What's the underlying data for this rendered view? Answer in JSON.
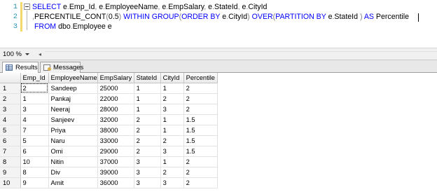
{
  "editor": {
    "lines": [
      {
        "number": "1",
        "tokens": [
          {
            "text": "SELECT",
            "kind": "kw"
          },
          {
            "text": " e",
            "kind": "pl"
          },
          {
            "text": ".",
            "kind": "op"
          },
          {
            "text": "Emp_Id",
            "kind": "pl"
          },
          {
            "text": ",",
            "kind": "op"
          },
          {
            "text": " e",
            "kind": "pl"
          },
          {
            "text": ".",
            "kind": "op"
          },
          {
            "text": "EmployeeName",
            "kind": "pl"
          },
          {
            "text": ",",
            "kind": "op"
          },
          {
            "text": " e",
            "kind": "pl"
          },
          {
            "text": ".",
            "kind": "op"
          },
          {
            "text": "EmpSalary",
            "kind": "pl"
          },
          {
            "text": ",",
            "kind": "op"
          },
          {
            "text": " e",
            "kind": "pl"
          },
          {
            "text": ".",
            "kind": "op"
          },
          {
            "text": "StateId",
            "kind": "pl"
          },
          {
            "text": ",",
            "kind": "op"
          },
          {
            "text": " e",
            "kind": "pl"
          },
          {
            "text": ".",
            "kind": "op"
          },
          {
            "text": "CityId",
            "kind": "pl"
          }
        ]
      },
      {
        "number": "2",
        "tokens": [
          {
            "text": ",",
            "kind": "op"
          },
          {
            "text": "PERCENTILE_CONT",
            "kind": "pl"
          },
          {
            "text": "(",
            "kind": "op"
          },
          {
            "text": "0.5",
            "kind": "pl"
          },
          {
            "text": ")",
            "kind": "op"
          },
          {
            "text": " WITHIN GROUP",
            "kind": "kw"
          },
          {
            "text": "(",
            "kind": "op"
          },
          {
            "text": "ORDER BY",
            "kind": "kw"
          },
          {
            "text": " e",
            "kind": "pl"
          },
          {
            "text": ".",
            "kind": "op"
          },
          {
            "text": "CityId",
            "kind": "pl"
          },
          {
            "text": ")",
            "kind": "op"
          },
          {
            "text": " OVER",
            "kind": "kw"
          },
          {
            "text": "(",
            "kind": "op"
          },
          {
            "text": "PARTITION BY",
            "kind": "kw"
          },
          {
            "text": " e",
            "kind": "pl"
          },
          {
            "text": ".",
            "kind": "op"
          },
          {
            "text": "StateId ",
            "kind": "pl"
          },
          {
            "text": ")",
            "kind": "op"
          },
          {
            "text": " AS",
            "kind": "kw"
          },
          {
            "text": " Percentile",
            "kind": "pl"
          }
        ]
      },
      {
        "number": "3",
        "tokens": [
          {
            "text": " FROM",
            "kind": "kw"
          },
          {
            "text": " dbo",
            "kind": "pl"
          },
          {
            "text": ".",
            "kind": "op"
          },
          {
            "text": "Employee e",
            "kind": "pl"
          }
        ]
      }
    ]
  },
  "zoom": {
    "value": "100 %"
  },
  "tabs": {
    "results_label": "Results",
    "messages_label": "Messages"
  },
  "results": {
    "columns": [
      "",
      "Emp_Id",
      "EmployeeName",
      "EmpSalary",
      "StateId",
      "CityId",
      "Percentile"
    ],
    "rows": [
      [
        "1",
        "2",
        "Sandeep",
        "25000",
        "1",
        "1",
        "2"
      ],
      [
        "2",
        "1",
        "Pankaj",
        "22000",
        "1",
        "2",
        "2"
      ],
      [
        "3",
        "3",
        "Neeraj",
        "28000",
        "1",
        "3",
        "2"
      ],
      [
        "4",
        "4",
        "Sanjeev",
        "32000",
        "2",
        "1",
        "1.5"
      ],
      [
        "5",
        "7",
        "Priya",
        "38000",
        "2",
        "1",
        "1.5"
      ],
      [
        "6",
        "5",
        "Naru",
        "33000",
        "2",
        "2",
        "1.5"
      ],
      [
        "7",
        "6",
        "Omi",
        "29000",
        "2",
        "3",
        "1.5"
      ],
      [
        "8",
        "10",
        "Nitin",
        "37000",
        "3",
        "1",
        "2"
      ],
      [
        "9",
        "8",
        "Div",
        "39000",
        "3",
        "2",
        "2"
      ],
      [
        "10",
        "9",
        "Amit",
        "36000",
        "3",
        "3",
        "2"
      ]
    ]
  },
  "colors": {
    "keyword": "#0000ff",
    "operator": "#808080",
    "line_number": "#2b91af",
    "change_bar": "#f3d86a"
  },
  "icons": {
    "results_tab": "grid-icon",
    "messages_tab": "messages-icon",
    "outline": "collapse-box-icon"
  }
}
